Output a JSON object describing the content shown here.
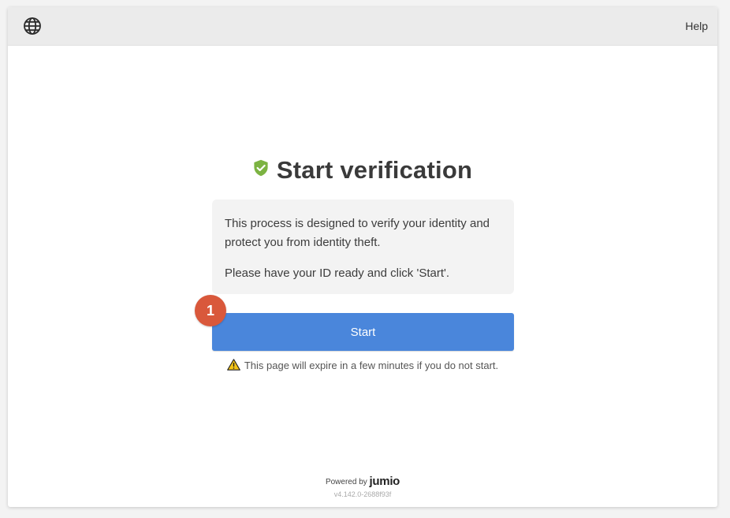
{
  "header": {
    "language_icon": "globe-icon",
    "help_label": "Help"
  },
  "main": {
    "title": "Start verification",
    "title_icon": "shield-check-icon",
    "info_lines": [
      "This process is designed to verify your identity and protect you from identity theft.",
      "Please have your ID ready and click 'Start'."
    ],
    "step_badge": "1",
    "start_label": "Start",
    "expire_notice": "This page will expire in a few minutes if you do not start.",
    "expire_icon": "warning-icon"
  },
  "footer": {
    "powered_by": "Powered by",
    "brand": "jumio",
    "version": "v4.142.0-2688f93f"
  },
  "colors": {
    "accent": "#4a86db",
    "shield": "#7cb342",
    "badge": "#d9583b",
    "warning": "#f5c518"
  }
}
